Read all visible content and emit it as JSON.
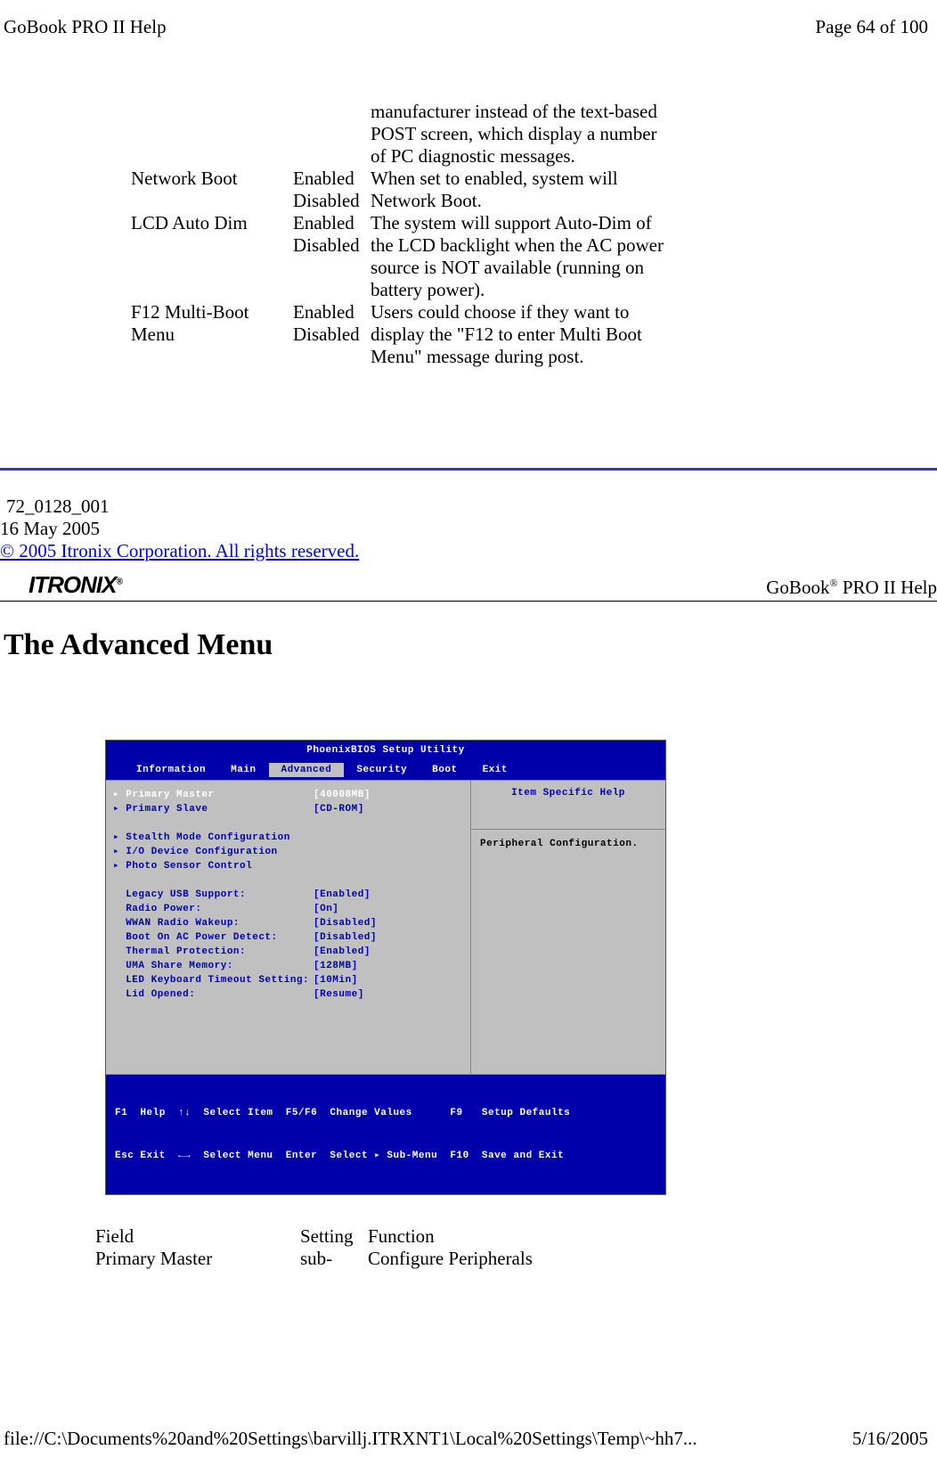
{
  "header": {
    "title": "GoBook PRO II Help",
    "page_info": "Page 64 of 100"
  },
  "footer": {
    "path": "file://C:\\Documents%20and%20Settings\\barvillj.ITRXNT1\\Local%20Settings\\Temp\\~hh7...",
    "date": "5/16/2005"
  },
  "settings_table": {
    "prev_function": "manufacturer instead of the text-based POST screen, which display a number of PC diagnostic messages.",
    "rows": [
      {
        "field": "Network Boot",
        "setting": "Enabled Disabled",
        "function": "When set to enabled, system will Network Boot."
      },
      {
        "field": "LCD Auto Dim",
        "setting": "Enabled Disabled",
        "function": "The system will support Auto-Dim of the LCD backlight when the AC power source is NOT available (running on battery power)."
      },
      {
        "field": "F12 Multi-Boot Menu",
        "setting": "Enabled Disabled",
        "function": "Users could choose if they want to display the \"F12 to enter Multi Boot Menu\" message during post."
      }
    ]
  },
  "doc": {
    "number": "72_0128_001",
    "date": "16 May 2005",
    "copyright": "© 2005 Itronix Corporation.  All rights reserved.",
    "brand": "ITRONIX",
    "reg": "®",
    "product": "GoBook",
    "product_reg": "®",
    "product_suffix": " PRO II Help"
  },
  "section_title": "The Advanced Menu",
  "bios": {
    "title": "PhoenixBIOS  Setup Utility",
    "tabs": [
      "Information",
      "Main",
      "Advanced",
      "Security",
      "Boot",
      "Exit"
    ],
    "active_tab": "Advanced",
    "help_title": "Item Specific Help",
    "help_body": "Peripheral Configuration.",
    "left_rows": [
      {
        "arrow": true,
        "hl": true,
        "label": "Primary Master",
        "value": "[40008MB]"
      },
      {
        "arrow": true,
        "label": "Primary Slave",
        "value": "[CD-ROM]"
      },
      {
        "spacer": true
      },
      {
        "arrow": true,
        "label": "Stealth Mode Configuration",
        "value": ""
      },
      {
        "arrow": true,
        "label": "I/O Device Configuration",
        "value": ""
      },
      {
        "arrow": true,
        "label": "Photo Sensor Control",
        "value": ""
      },
      {
        "spacer": true
      },
      {
        "label": "Legacy USB Support:",
        "value": "[Enabled]"
      },
      {
        "label": "Radio Power:",
        "value": "[On]"
      },
      {
        "label": "WWAN Radio Wakeup:",
        "value": "[Disabled]"
      },
      {
        "label": "Boot On AC Power Detect:",
        "value": "[Disabled]"
      },
      {
        "label": "Thermal Protection:",
        "value": "[Enabled]"
      },
      {
        "label": "UMA Share Memory:",
        "value": "[128MB]"
      },
      {
        "label": "LED Keyboard Timeout Setting:",
        "value": "[10Min]"
      },
      {
        "label": "Lid Opened:",
        "value": "[Resume]"
      }
    ],
    "footer_line1": "F1  Help  ↑↓  Select Item  F5/F6  Change Values      F9   Setup Defaults",
    "footer_line2": "Esc Exit  ←→  Select Menu  Enter  Select ▸ Sub-Menu  F10  Save and Exit"
  },
  "adv_table": {
    "header": {
      "field": "Field",
      "setting": "Setting",
      "function": "Function"
    },
    "rows": [
      {
        "field": "Primary Master",
        "setting": "sub-",
        "function": "Configure Peripherals"
      }
    ]
  }
}
